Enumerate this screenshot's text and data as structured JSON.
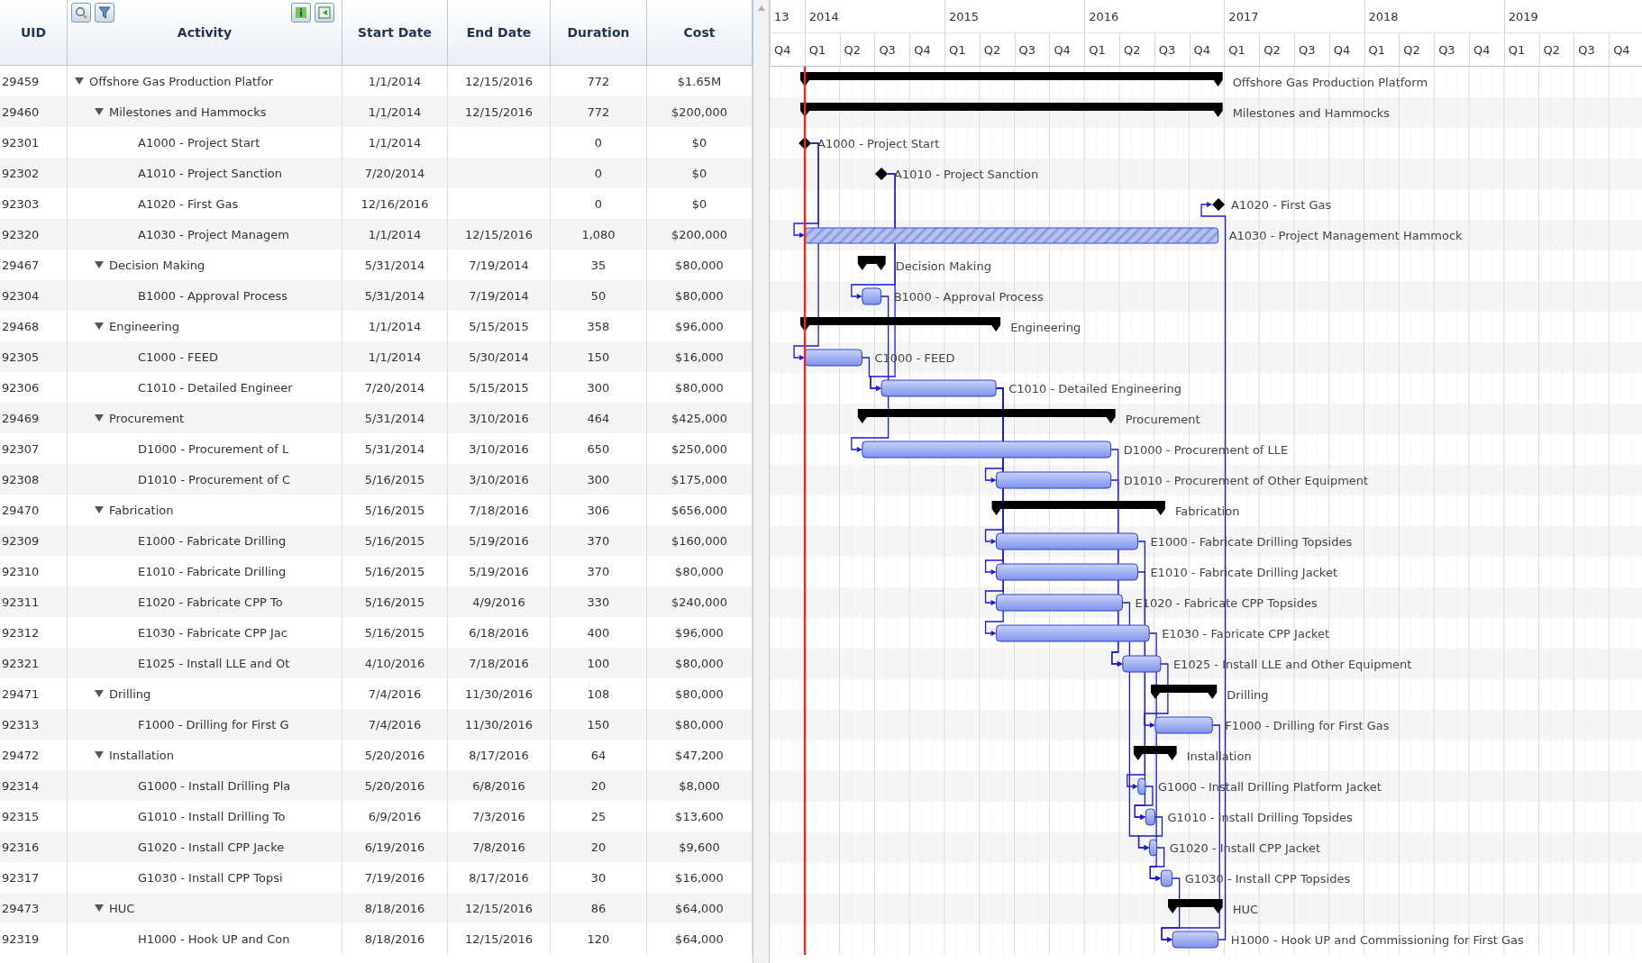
{
  "grid": {
    "columns": [
      "UID",
      "Activity",
      "Start Date",
      "End Date",
      "Duration",
      "Cost"
    ],
    "activities": [
      {
        "uid": "29459",
        "activity": "Offshore Gas Production Platfor",
        "kind": "summary",
        "expanded": true,
        "start": "1/1/2014",
        "end": "12/15/2016",
        "duration": "772",
        "cost": "$1.65M",
        "bar_label": "Offshore Gas Production Platform",
        "children": [
          {
            "uid": "29460",
            "activity": "Milestones and Hammocks",
            "kind": "summary",
            "expanded": true,
            "start": "1/1/2014",
            "end": "12/15/2016",
            "duration": "772",
            "cost": "$200,000",
            "bar_label": "Milestones and Hammocks",
            "children": [
              {
                "uid": "92301",
                "activity": "A1000 - Project Start",
                "kind": "milestone",
                "start": "1/1/2014",
                "duration": "0",
                "cost": "$0",
                "bar_label": "A1000 - Project Start"
              },
              {
                "uid": "92302",
                "activity": "A1010 - Project Sanction",
                "kind": "milestone",
                "start": "7/20/2014",
                "duration": "0",
                "cost": "$0",
                "bar_label": "A1010 - Project Sanction"
              },
              {
                "uid": "92303",
                "activity": "A1020 - First Gas",
                "kind": "milestone",
                "start": "12/16/2016",
                "duration": "0",
                "cost": "$0",
                "bar_label": "A1020 - First Gas"
              },
              {
                "uid": "92320",
                "activity": "A1030 - Project Managem",
                "kind": "hammock",
                "start": "1/1/2014",
                "end": "12/15/2016",
                "duration": "1,080",
                "cost": "$200,000",
                "bar_label": "A1030 - Project Management Hammock"
              }
            ]
          },
          {
            "uid": "29467",
            "activity": "Decision Making",
            "kind": "summary",
            "expanded": true,
            "start": "5/31/2014",
            "end": "7/19/2014",
            "duration": "35",
            "cost": "$80,000",
            "bar_label": "Decision Making",
            "children": [
              {
                "uid": "92304",
                "activity": "B1000 - Approval Process",
                "kind": "task",
                "start": "5/31/2014",
                "end": "7/19/2014",
                "duration": "50",
                "cost": "$80,000",
                "bar_label": "B1000 - Approval Process"
              }
            ]
          },
          {
            "uid": "29468",
            "activity": "Engineering",
            "kind": "summary",
            "expanded": true,
            "start": "1/1/2014",
            "end": "5/15/2015",
            "duration": "358",
            "cost": "$96,000",
            "bar_label": "Engineering",
            "children": [
              {
                "uid": "92305",
                "activity": "C1000 - FEED",
                "kind": "task",
                "start": "1/1/2014",
                "end": "5/30/2014",
                "duration": "150",
                "cost": "$16,000",
                "bar_label": "C1000 - FEED"
              },
              {
                "uid": "92306",
                "activity": "C1010 - Detailed Engineer",
                "kind": "task",
                "start": "7/20/2014",
                "end": "5/15/2015",
                "duration": "300",
                "cost": "$80,000",
                "bar_label": "C1010 - Detailed Engineering"
              }
            ]
          },
          {
            "uid": "29469",
            "activity": "Procurement",
            "kind": "summary",
            "expanded": true,
            "start": "5/31/2014",
            "end": "3/10/2016",
            "duration": "464",
            "cost": "$425,000",
            "bar_label": "Procurement",
            "children": [
              {
                "uid": "92307",
                "activity": "D1000 - Procurement of L",
                "kind": "task",
                "start": "5/31/2014",
                "end": "3/10/2016",
                "duration": "650",
                "cost": "$250,000",
                "bar_label": "D1000 - Procurement of LLE"
              },
              {
                "uid": "92308",
                "activity": "D1010 - Procurement of C",
                "kind": "task",
                "start": "5/16/2015",
                "end": "3/10/2016",
                "duration": "300",
                "cost": "$175,000",
                "bar_label": "D1010 - Procurement of Other Equipment"
              }
            ]
          },
          {
            "uid": "29470",
            "activity": "Fabrication",
            "kind": "summary",
            "expanded": true,
            "start": "5/16/2015",
            "end": "7/18/2016",
            "duration": "306",
            "cost": "$656,000",
            "bar_label": "Fabrication",
            "children": [
              {
                "uid": "92309",
                "activity": "E1000 - Fabricate Drilling",
                "kind": "task",
                "start": "5/16/2015",
                "end": "5/19/2016",
                "duration": "370",
                "cost": "$160,000",
                "bar_label": "E1000 - Fabricate Drilling Topsides"
              },
              {
                "uid": "92310",
                "activity": "E1010 - Fabricate Drilling",
                "kind": "task",
                "start": "5/16/2015",
                "end": "5/19/2016",
                "duration": "370",
                "cost": "$80,000",
                "bar_label": "E1010 - Fabricate Drilling Jacket"
              },
              {
                "uid": "92311",
                "activity": "E1020 - Fabricate CPP To",
                "kind": "task",
                "start": "5/16/2015",
                "end": "4/9/2016",
                "duration": "330",
                "cost": "$240,000",
                "bar_label": "E1020 - Fabricate CPP Topsides"
              },
              {
                "uid": "92312",
                "activity": "E1030 - Fabricate CPP Jac",
                "kind": "task",
                "start": "5/16/2015",
                "end": "6/18/2016",
                "duration": "400",
                "cost": "$96,000",
                "bar_label": "E1030 - Fabricate CPP Jacket"
              },
              {
                "uid": "92321",
                "activity": "E1025 - Install LLE and Ot",
                "kind": "task",
                "start": "4/10/2016",
                "end": "7/18/2016",
                "duration": "100",
                "cost": "$80,000",
                "bar_label": "E1025 - Install LLE and Other Equipment"
              }
            ]
          },
          {
            "uid": "29471",
            "activity": "Drilling",
            "kind": "summary",
            "expanded": true,
            "start": "7/4/2016",
            "end": "11/30/2016",
            "duration": "108",
            "cost": "$80,000",
            "bar_label": "Drilling",
            "children": [
              {
                "uid": "92313",
                "activity": "F1000 - Drilling for First G",
                "kind": "task",
                "start": "7/4/2016",
                "end": "11/30/2016",
                "duration": "150",
                "cost": "$80,000",
                "bar_label": "F1000 - Drilling for First Gas"
              }
            ]
          },
          {
            "uid": "29472",
            "activity": "Installation",
            "kind": "summary",
            "expanded": true,
            "start": "5/20/2016",
            "end": "8/17/2016",
            "duration": "64",
            "cost": "$47,200",
            "bar_label": "Installation",
            "children": [
              {
                "uid": "92314",
                "activity": "G1000 - Install Drilling Pla",
                "kind": "task",
                "start": "5/20/2016",
                "end": "6/8/2016",
                "duration": "20",
                "cost": "$8,000",
                "bar_label": "G1000 - Install Drilling Platform Jacket"
              },
              {
                "uid": "92315",
                "activity": "G1010 - Install Drilling To",
                "kind": "task",
                "start": "6/9/2016",
                "end": "7/3/2016",
                "duration": "25",
                "cost": "$13,600",
                "bar_label": "G1010 - Install Drilling Topsides"
              },
              {
                "uid": "92316",
                "activity": "G1020 - Install CPP Jacke",
                "kind": "task",
                "start": "6/19/2016",
                "end": "7/8/2016",
                "duration": "20",
                "cost": "$9,600",
                "bar_label": "G1020 - Install CPP Jacket"
              },
              {
                "uid": "92317",
                "activity": "G1030 - Install CPP Topsi",
                "kind": "task",
                "start": "7/19/2016",
                "end": "8/17/2016",
                "duration": "30",
                "cost": "$16,000",
                "bar_label": "G1030 - Install CPP Topsides"
              }
            ]
          },
          {
            "uid": "29473",
            "activity": "HUC",
            "kind": "summary",
            "expanded": true,
            "start": "8/18/2016",
            "end": "12/15/2016",
            "duration": "86",
            "cost": "$64,000",
            "bar_label": "HUC",
            "children": [
              {
                "uid": "92319",
                "activity": "H1000 - Hook UP and Con",
                "kind": "task",
                "start": "8/18/2016",
                "end": "12/15/2016",
                "duration": "120",
                "cost": "$64,000",
                "bar_label": "H1000 - Hook UP and Commissioning for First Gas"
              }
            ]
          }
        ]
      }
    ]
  },
  "timeline": {
    "years": [
      "13",
      "2014",
      "2015",
      "2016",
      "2017",
      "2018",
      "2019"
    ],
    "quarters": [
      "Q4",
      "Q1",
      "Q2",
      "Q3",
      "Q4",
      "Q1",
      "Q2",
      "Q3",
      "Q4",
      "Q1",
      "Q2",
      "Q3",
      "Q4",
      "Q1",
      "Q2",
      "Q3",
      "Q4",
      "Q1",
      "Q2",
      "Q3",
      "Q4",
      "Q1",
      "Q2",
      "Q3",
      "Q4"
    ]
  }
}
